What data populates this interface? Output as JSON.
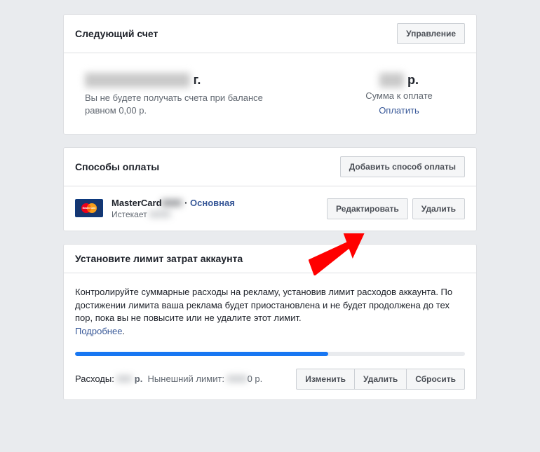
{
  "next_bill": {
    "title": "Следующий счет",
    "manage_btn": "Управление",
    "date_hidden": "00 февраля 0000",
    "date_suffix": "г.",
    "note": "Вы не будете получать счета при балансе равном 0,00 р.",
    "amount_hidden": "0,00",
    "currency": "р.",
    "amount_label": "Сумма к оплате",
    "pay_link": "Оплатить"
  },
  "payment_methods": {
    "title": "Способы оплаты",
    "add_btn": "Добавить способ оплаты",
    "card_name": "MasterCard",
    "card_num_hidden": "0000",
    "separator": " · ",
    "primary": "Основная",
    "expires_label": "Истекает",
    "expires_hidden": "00/00",
    "edit_btn": "Редактировать",
    "delete_btn": "Удалить"
  },
  "spend_limit": {
    "title": "Установите лимит затрат аккаунта",
    "description": "Контролируйте суммарные расходы на рекламу, установив лимит расходов аккаунта. По достижении лимита ваша реклама будет приостановлена и не будет продолжена до тех пор, пока вы не повысите или не удалите этот лимит.",
    "learn_more": "Подробнее",
    "learn_more_dot": ".",
    "expenses_label": "Расходы: ",
    "expenses_hidden": "000",
    "currency": "р.",
    "current_limit_label": "Нынешний лимит: ",
    "limit_hidden": "0000",
    "limit_suffix": "0 р.",
    "change_btn": "Изменить",
    "delete_btn": "Удалить",
    "reset_btn": "Сбросить"
  }
}
